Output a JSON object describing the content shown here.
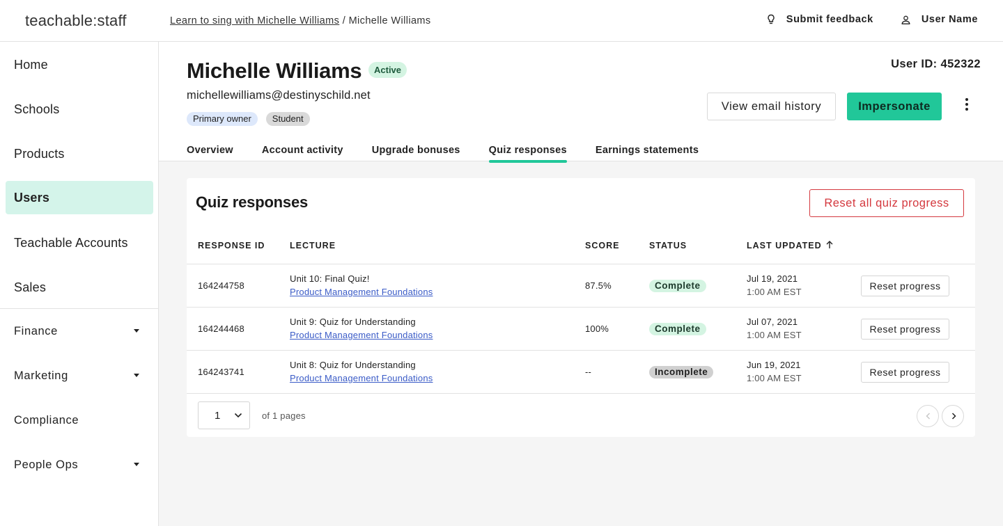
{
  "app": {
    "logo": "teachable:staff"
  },
  "topbar": {
    "breadcrumb_link": "Learn to sing with Michelle Williams",
    "breadcrumb_separator": " / ",
    "breadcrumb_current": "Michelle Williams",
    "feedback_label": "Submit feedback",
    "feedback_icon": "lightbulb-icon",
    "user_label": "User Name",
    "user_icon": "person-icon"
  },
  "sidebar": {
    "items": [
      {
        "label": "Home"
      },
      {
        "label": "Schools"
      },
      {
        "label": "Products"
      },
      {
        "label": "Users",
        "active": true
      },
      {
        "label": "Teachable Accounts"
      },
      {
        "label": "Sales"
      },
      {
        "label": "Finance",
        "has_caret": true
      },
      {
        "label": "Marketing",
        "has_caret": true
      },
      {
        "label": "Compliance"
      },
      {
        "label": "People Ops",
        "has_caret": true
      }
    ]
  },
  "user": {
    "name": "Michelle Williams",
    "status": "Active",
    "email": "michellewilliams@destinyschild.net",
    "roles": [
      "Primary owner",
      "Student"
    ],
    "user_id_label": "User ID: 452322"
  },
  "actions": {
    "email_history": "View email history",
    "impersonate": "Impersonate"
  },
  "tabs": [
    {
      "label": "Overview"
    },
    {
      "label": "Account activity"
    },
    {
      "label": "Upgrade bonuses"
    },
    {
      "label": "Quiz responses",
      "active": true
    },
    {
      "label": "Earnings statements"
    }
  ],
  "quiz": {
    "title": "Quiz responses",
    "reset_all": "Reset all quiz progress",
    "columns": {
      "response_id": "RESPONSE ID",
      "lecture": "LECTURE",
      "score": "SCORE",
      "status": "STATUS",
      "last_updated": "LAST UPDATED"
    },
    "rows": [
      {
        "id": "164244758",
        "lecture": "Unit 10: Final Quiz!",
        "course": "Product Management Foundations",
        "score": "87.5%",
        "status": "Complete",
        "date": "Jul 19, 2021",
        "time": "1:00 AM EST",
        "action": "Reset progress"
      },
      {
        "id": "164244468",
        "lecture": "Unit 9: Quiz for Understanding",
        "course": "Product Management Foundations",
        "score": "100%",
        "status": "Complete",
        "date": "Jul 07, 2021",
        "time": "1:00 AM EST",
        "action": "Reset progress"
      },
      {
        "id": "164243741",
        "lecture": "Unit 8: Quiz for Understanding",
        "course": "Product Management Foundations",
        "score": "--",
        "status": "Incomplete",
        "date": "Jun 19, 2021",
        "time": "1:00 AM EST",
        "action": "Reset progress"
      }
    ],
    "pagination": {
      "current_page": "1",
      "page_info": "of 1 pages"
    }
  },
  "colors": {
    "accent": "#21c799",
    "danger": "#d4383e",
    "link": "#3a5bc7",
    "active_nav_bg": "#d4f4ea"
  }
}
